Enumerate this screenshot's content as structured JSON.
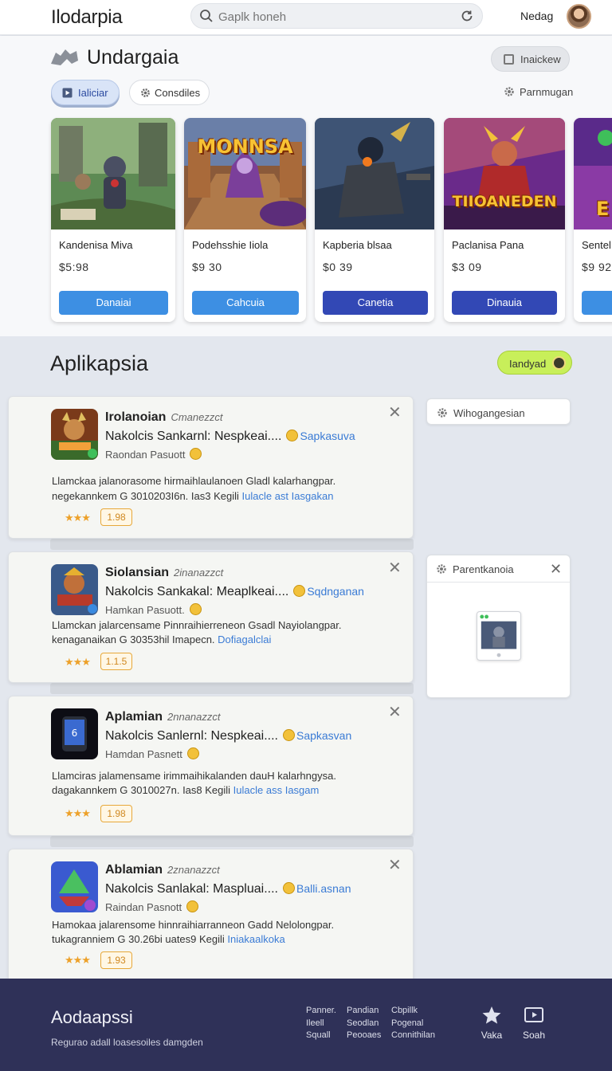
{
  "header": {
    "brand": "Ilodarpia",
    "search_placeholder": "Gaplk honeh",
    "user_name": "Nedag"
  },
  "featured": {
    "title": "Undargaia",
    "action_label": "Inaickew",
    "tabs": [
      {
        "label": "Ialiciar",
        "active": true
      },
      {
        "label": "Consdiles",
        "active": false
      }
    ],
    "filter_label": "Parnmugan",
    "cards": [
      {
        "name": "Kandenisa Miva",
        "price": "$5:98",
        "button": "Danaiai",
        "button_color": "#3d8fe3",
        "art_text": ""
      },
      {
        "name": "Podehsshie Iiola",
        "price": "$9 30",
        "button": "Cahcuia",
        "button_color": "#3d8fe3",
        "art_text": "MONNSA"
      },
      {
        "name": "Kapberia blsaa",
        "price": "$0 39",
        "button": "Canetia",
        "button_color": "#3248b5",
        "art_text": ""
      },
      {
        "name": "Paclanisa Pana",
        "price": "$3 09",
        "button": "Dinauia",
        "button_color": "#3248b5",
        "art_text": "TIIOANEDEN"
      },
      {
        "name": "Sentel",
        "price": "$9 92",
        "button": "",
        "button_color": "#3d8fe3",
        "art_text": "E"
      }
    ]
  },
  "apps": {
    "title": "Aplikapsia",
    "badge": "Iandyad",
    "items": [
      {
        "name": "Irolanoian",
        "date": "Cmanezzct",
        "subtitle": "Nakolcis Sankarnl: Nespkeai....",
        "tag": "Sapkasuva",
        "developer": "Raondan Pasuott",
        "desc1": "Llamckaa jalanorasome hirmaihlaulanoen Gladl kalarhangpar.",
        "desc2_text": "negekannkem G 3010203I6n. Ias3 Kegili ",
        "desc2_link": "Iulacle ast Iasgakan",
        "rating": "1.98"
      },
      {
        "name": "Siolansian",
        "date": "2inanazzct",
        "subtitle": "Nakolcis Sankakal: Meaplkeai....",
        "tag": "Sqdnganan",
        "developer": "Hamkan Pasuott.",
        "desc1": "Llamckan jalarcensame Pinnraihierreneon Gsadl Nayiolangpar.",
        "desc2_text": "kenaganaikan G 30353hil Imapecn. ",
        "desc2_link": "Dofiagalclai",
        "rating": "1.1.5"
      },
      {
        "name": "Aplamian",
        "date": "2nnanazzct",
        "subtitle": "Nakolcis Sanlernl: Nespkeai....",
        "tag": "Sapkasvan",
        "developer": "Hamdan Pasnett",
        "desc1": "Llamciras jalamensame irimmaihikalanden dauH kalarhngysa.",
        "desc2_text": "dagakannkem G 3010027n. Ias8 Kegili ",
        "desc2_link": "Iulacle ass Iasgam",
        "rating": "1.98"
      },
      {
        "name": "Ablamian",
        "date": "2znanazzct",
        "subtitle": "Nakolcis Sanlakal: Maspluai....",
        "tag": "Balli.asnan",
        "developer": "Raindan Pasnott",
        "desc1": "Hamokaa jalarensome hinnraihiarranneon Gadd Nelolongpar.",
        "desc2_text": "tukagranniem G 30.26bi uates9 Kegili ",
        "desc2_link": "Iniakaalkoka",
        "rating": "1.93"
      }
    ],
    "side_pill": "Wihogangesian",
    "side_panel_title": "Parentkanoia"
  },
  "footer": {
    "title": "Aodaapssi",
    "subtitle": "Regurao adall loasesoiles damgden",
    "col1": [
      "Panner.",
      "Ileell",
      "Squall"
    ],
    "col2": [
      "Pandian",
      "Seodlan",
      "Peooaes"
    ],
    "col3": [
      "Cbpillk",
      "Pogenal",
      "Connithilan"
    ],
    "action1": "Vaka",
    "action2": "Soah"
  }
}
